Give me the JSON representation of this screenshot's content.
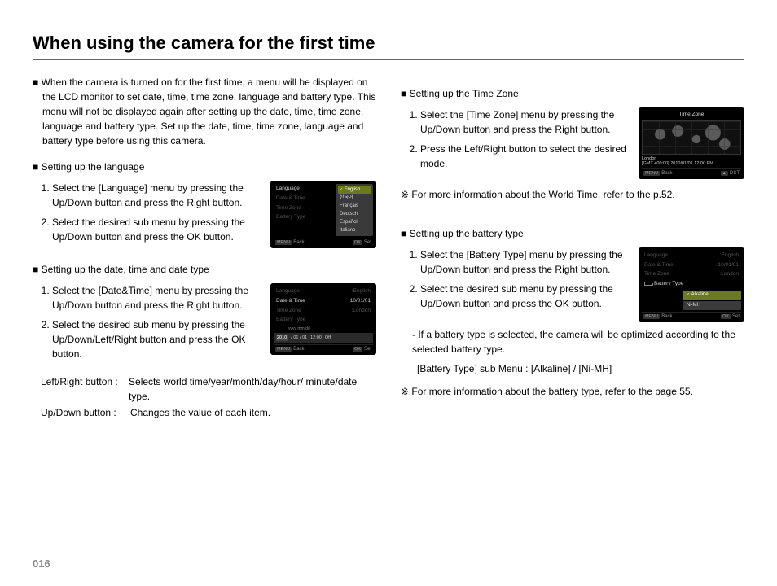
{
  "page_number": "016",
  "title": "When using the camera for the first time",
  "left": {
    "intro": "When the camera is turned on for the first time, a menu will be displayed on the LCD monitor to set date, time, time zone, language and battery type. This menu will not be displayed again after setting up the date, time, time zone, language and battery type. Set up the date, time, time zone, language and battery type before using this camera.",
    "lang_head": "Setting up the language",
    "lang_steps": [
      "Select the [Language] menu by pressing the Up/Down button and press the Right button.",
      "Select the desired sub menu by pressing the Up/Down button and press the OK button."
    ],
    "dt_head": "Setting up the date, time and date type",
    "dt_steps": [
      "Select the [Date&Time] menu by pressing the Up/Down button and press the Right button.",
      "Select the desired sub menu by pressing the Up/Down/Left/Right button and press the OK button."
    ],
    "btn_lr_k": "Left/Right button :",
    "btn_lr_v": "Selects world time/year/month/day/hour/ minute/date type.",
    "btn_ud_k": "Up/Down button  :",
    "btn_ud_v": "Changes the value of each item."
  },
  "right": {
    "tz_head": "Setting up the Time Zone",
    "tz_steps": [
      "Select the [Time Zone] menu by pressing the Up/Down button and press the Right button.",
      "Press the Left/Right button to select the desired mode."
    ],
    "tz_note": "For more information about the World Time, refer to the p.52.",
    "bt_head": "Setting up the battery type",
    "bt_steps": [
      "Select the [Battery Type] menu by pressing the Up/Down button and press the Right button.",
      "Select the desired sub menu by pressing the Up/Down button and press the OK button."
    ],
    "bt_opt_note": "- If a battery type is selected, the camera will be optimized according to the selected battery type.",
    "bt_sub": "[Battery Type] sub Menu : [Alkaline] / [Ni-MH]",
    "bt_more": "For more information about the battery type, refer to the page 55."
  },
  "lcd": {
    "menu": {
      "language": "Language",
      "datetime": "Date & Time",
      "timezone": "Time Zone",
      "battery": "Battery Type"
    },
    "lang_options": [
      "English",
      "한국어",
      "Français",
      "Deutsch",
      "Español",
      "Italiano"
    ],
    "dt_value": ":10/01/01",
    "dt_fmt": "yyyy mm dd",
    "dt_edit": [
      "2010",
      "/ 01 / 01",
      "12:00",
      "Off"
    ],
    "tz_title": "Time Zone",
    "tz_city": "London",
    "tz_line": "[GMT +00:00]   2010/01/01   12:00 PM",
    "bat_lang_val": ":English",
    "bat_dt_val": ":10/01/01",
    "bat_tz_val": ":London",
    "bat_options": [
      "Alkaline",
      "Ni-MH"
    ],
    "footer_back_key": "MENU",
    "footer_back": "Back",
    "footer_set_key": "OK",
    "footer_set": "Set",
    "footer_dst": "DST"
  }
}
